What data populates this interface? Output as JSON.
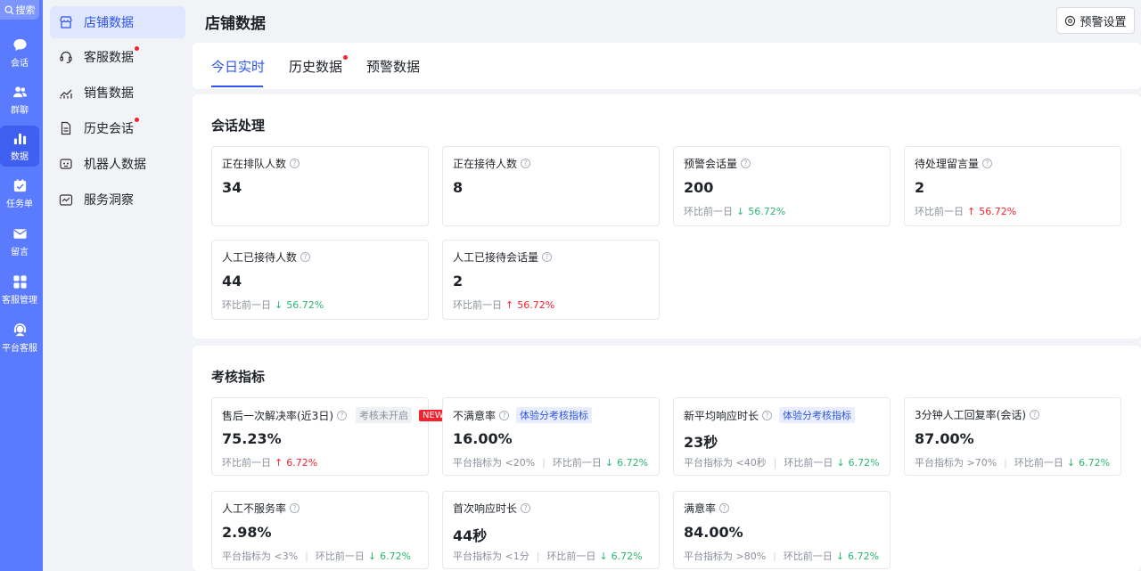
{
  "rail": {
    "search_label": "搜索",
    "items": [
      {
        "label": "会话",
        "icon": "chat-icon"
      },
      {
        "label": "群聊",
        "icon": "group-icon"
      },
      {
        "label": "数据",
        "icon": "bar-chart-icon"
      },
      {
        "label": "任务单",
        "icon": "task-icon"
      },
      {
        "label": "留言",
        "icon": "mail-icon"
      },
      {
        "label": "客服管理",
        "icon": "grid-icon"
      },
      {
        "label": "平台客服",
        "icon": "support-icon"
      }
    ],
    "active_index": 2,
    "accent": "#5b7bff"
  },
  "sidebar": {
    "items": [
      {
        "label": "店铺数据",
        "icon": "shop-icon",
        "dot": false
      },
      {
        "label": "客服数据",
        "icon": "headset-icon",
        "dot": true
      },
      {
        "label": "销售数据",
        "icon": "trend-icon",
        "dot": false
      },
      {
        "label": "历史会话",
        "icon": "document-icon",
        "dot": true
      },
      {
        "label": "机器人数据",
        "icon": "robot-icon",
        "dot": false
      },
      {
        "label": "服务洞察",
        "icon": "insight-icon",
        "dot": false
      }
    ],
    "active_index": 0
  },
  "header": {
    "title": "店铺数据",
    "warn_button": "预警设置"
  },
  "tabs": [
    {
      "label": "今日实时",
      "dot": false
    },
    {
      "label": "历史数据",
      "dot": true
    },
    {
      "label": "预警数据",
      "dot": false
    }
  ],
  "session": {
    "title": "会话处理",
    "cards": [
      {
        "label": "正在排队人数",
        "value": "34",
        "compare": "",
        "change": "",
        "dir": ""
      },
      {
        "label": "正在接待人数",
        "value": "8",
        "compare": "",
        "change": "",
        "dir": ""
      },
      {
        "label": "预警会话量",
        "value": "200",
        "compare": "环比前一日",
        "change": "56.72%",
        "dir": "down"
      },
      {
        "label": "待处理留言量",
        "value": "2",
        "compare": "环比前一日",
        "change": "56.72%",
        "dir": "up"
      },
      {
        "label": "人工已接待人数",
        "value": "44",
        "compare": "环比前一日",
        "change": "56.72%",
        "dir": "down"
      },
      {
        "label": "人工已接待会话量",
        "value": "2",
        "compare": "环比前一日",
        "change": "56.72%",
        "dir": "up"
      }
    ]
  },
  "kpi": {
    "title": "考核指标",
    "cards": [
      {
        "label": "售后一次解决率(近3日)",
        "tag_gray": "考核未开启",
        "tag_new": "NEW",
        "tag_blue": "",
        "value": "75.23%",
        "platform": "",
        "compare": "环比前一日",
        "change": "6.72%",
        "dir": "up"
      },
      {
        "label": "不满意率",
        "tag_gray": "",
        "tag_new": "",
        "tag_blue": "体验分考核指标",
        "value": "16.00%",
        "platform": "平台指标为 <20%",
        "compare": "环比前一日",
        "change": "6.72%",
        "dir": "down"
      },
      {
        "label": "新平均响应时长",
        "tag_gray": "",
        "tag_new": "",
        "tag_blue": "体验分考核指标",
        "value": "23秒",
        "platform": "平台指标为 <40秒",
        "compare": "环比前一日",
        "change": "6.72%",
        "dir": "down"
      },
      {
        "label": "3分钟人工回复率(会话)",
        "tag_gray": "",
        "tag_new": "",
        "tag_blue": "",
        "value": "87.00%",
        "platform": "平台指标为 >70%",
        "compare": "环比前一日",
        "change": "6.72%",
        "dir": "down"
      },
      {
        "label": "人工不服务率",
        "tag_gray": "",
        "tag_new": "",
        "tag_blue": "",
        "value": "2.98%",
        "platform": "平台指标为 <3%",
        "compare": "环比前一日",
        "change": "6.72%",
        "dir": "down"
      },
      {
        "label": "首次响应时长",
        "tag_gray": "",
        "tag_new": "",
        "tag_blue": "",
        "value": "44秒",
        "platform": "平台指标为 <1分",
        "compare": "环比前一日",
        "change": "6.72%",
        "dir": "down"
      },
      {
        "label": "满意率",
        "tag_gray": "",
        "tag_new": "",
        "tag_blue": "",
        "value": "84.00%",
        "platform": "平台指标为 >80%",
        "compare": "环比前一日",
        "change": "6.72%",
        "dir": "down"
      }
    ]
  },
  "colors": {
    "primary": "#2f54eb",
    "up": "#f5222d",
    "down": "#2bb673"
  }
}
